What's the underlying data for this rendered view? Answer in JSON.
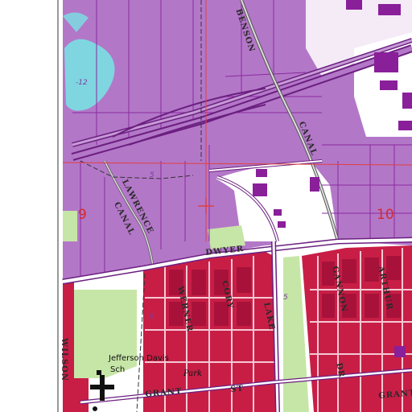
{
  "colors": {
    "urban": "#b377c8",
    "residential": "#c81e46",
    "water": "#7fd6e0",
    "vegetation": "#c6e6a7",
    "white": "#ffffff",
    "street": "#8a2b9e",
    "road_casing": "#6b1f80",
    "section_line": "#e04040",
    "building": "#8a1f9a"
  },
  "labels": {
    "benson": "BENSON",
    "canal_east": "CANAL",
    "lawrence": "LAWRENCE",
    "canal_west": "CANAL",
    "dwyer": "DWYER",
    "werner": "WERNER",
    "cory": "CORY",
    "lake": "LAKE",
    "gannon": "GANNON",
    "arthur": "ARTHUR",
    "grant": "GRANT",
    "grant_st": "ST",
    "dr": "DR",
    "wilson": "WILSON",
    "section_9": "9",
    "section_10": "10",
    "contour_12": "-12",
    "contour_5a": "5",
    "contour_5b": "5",
    "contour_6": "6",
    "school_name": "Jefferson Davis",
    "school_sch": "Sch",
    "park": "Park"
  }
}
